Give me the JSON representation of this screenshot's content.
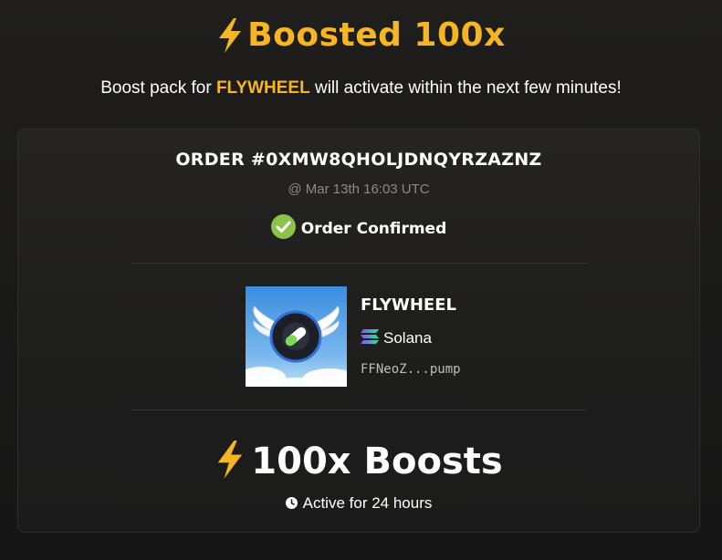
{
  "header": {
    "icon": "lightning-bolt-icon",
    "title": "Boosted 100x",
    "subtitle_before": "Boost pack for ",
    "subtitle_token": "FLYWHEEL",
    "subtitle_after": " will activate within the next few minutes!"
  },
  "order": {
    "id_label": "ORDER #0XMW8QHOLJDNQYRZAZNZ",
    "timestamp": "@ Mar 13th 16:03 UTC",
    "status_icon": "check-circle-icon",
    "status": "Order Confirmed"
  },
  "token": {
    "image_icon": "winged-wheel-icon",
    "name": "FLYWHEEL",
    "chain_icon": "solana-icon",
    "chain": "Solana",
    "address": "FFNeoZ...pump"
  },
  "boost": {
    "icon": "lightning-bolt-icon",
    "amount": "100x Boosts",
    "duration_icon": "clock-icon",
    "duration": "Active for 24 hours"
  },
  "colors": {
    "accent": "#f6b523",
    "success": "#8bc34a",
    "muted": "#8a8a8a"
  }
}
